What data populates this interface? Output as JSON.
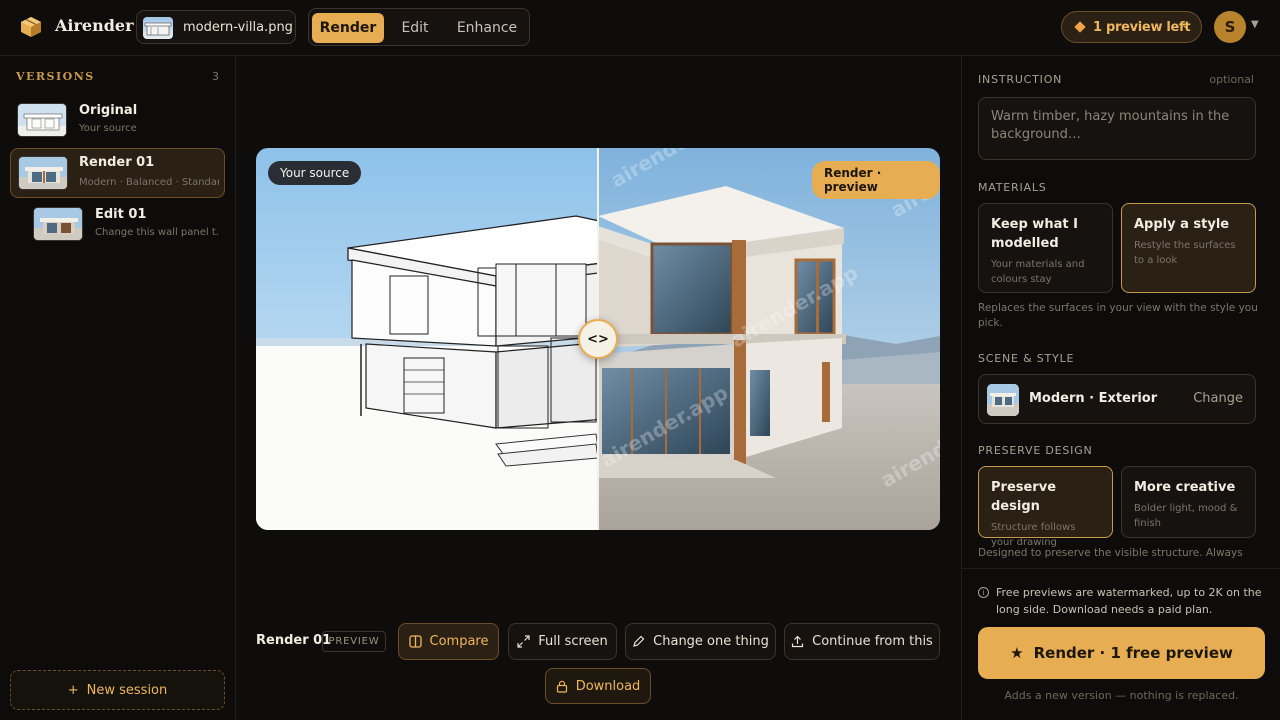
{
  "app": {
    "name": "Airender"
  },
  "file": {
    "name": "modern-villa.png"
  },
  "modes": [
    {
      "label": "Render",
      "active": true
    },
    {
      "label": "Edit",
      "active": false
    },
    {
      "label": "Enhance",
      "active": false
    }
  ],
  "preview": {
    "label": "1 preview left"
  },
  "user": {
    "initial": "S"
  },
  "sidebar": {
    "title": "VERSIONS",
    "count": "3",
    "items": [
      {
        "title": "Original",
        "subtitle": "Your source"
      },
      {
        "title": "Render 01",
        "subtitle": "Modern · Balanced · Standard"
      },
      {
        "title": "Edit 01",
        "subtitle": "Change this wall panel t..."
      }
    ],
    "new_session": "New session"
  },
  "stage": {
    "source_badge": "Your source",
    "render_badge": "Render · preview",
    "watermark": "airender.app",
    "handle_glyph": "<>"
  },
  "actions": {
    "render_label": "Render 01",
    "preview_tag": "PREVIEW",
    "compare": "Compare",
    "fullscreen": "Full screen",
    "change_one": "Change one thing",
    "continue": "Continue from this",
    "download": "Download"
  },
  "panel": {
    "instruction_label": "INSTRUCTION",
    "instruction_optional": "optional",
    "instruction_placeholder": "Warm timber, hazy mountains in the background…",
    "materials_label": "MATERIALS",
    "materials": [
      {
        "title": "Keep what I modelled",
        "subtitle": "Your materials and colours stay",
        "selected": false
      },
      {
        "title": "Apply a style",
        "subtitle": "Restyle the surfaces to a look",
        "selected": true
      }
    ],
    "materials_helper": "Replaces the surfaces in your view with the style you pick.",
    "scene_label": "SCENE & STYLE",
    "scene_name": "Modern · Exterior",
    "scene_change": "Change",
    "preserve_label": "PRESERVE DESIGN",
    "preserve": [
      {
        "title": "Preserve design",
        "subtitle": "Structure follows your drawing",
        "selected": true
      },
      {
        "title": "More creative",
        "subtitle": "Bolder light, mood & finish",
        "selected": false
      }
    ],
    "preserve_helper": "Designed to preserve the visible structure. Always",
    "info": "Free previews are watermarked, up to 2K on the long side. Download needs a paid plan.",
    "render_button": "Render · 1 free preview",
    "footnote": "Adds a new version — nothing is replaced."
  },
  "colors": {
    "accent": "#e6ad52",
    "background": "#0f0d0b",
    "panel": "#15120f"
  }
}
